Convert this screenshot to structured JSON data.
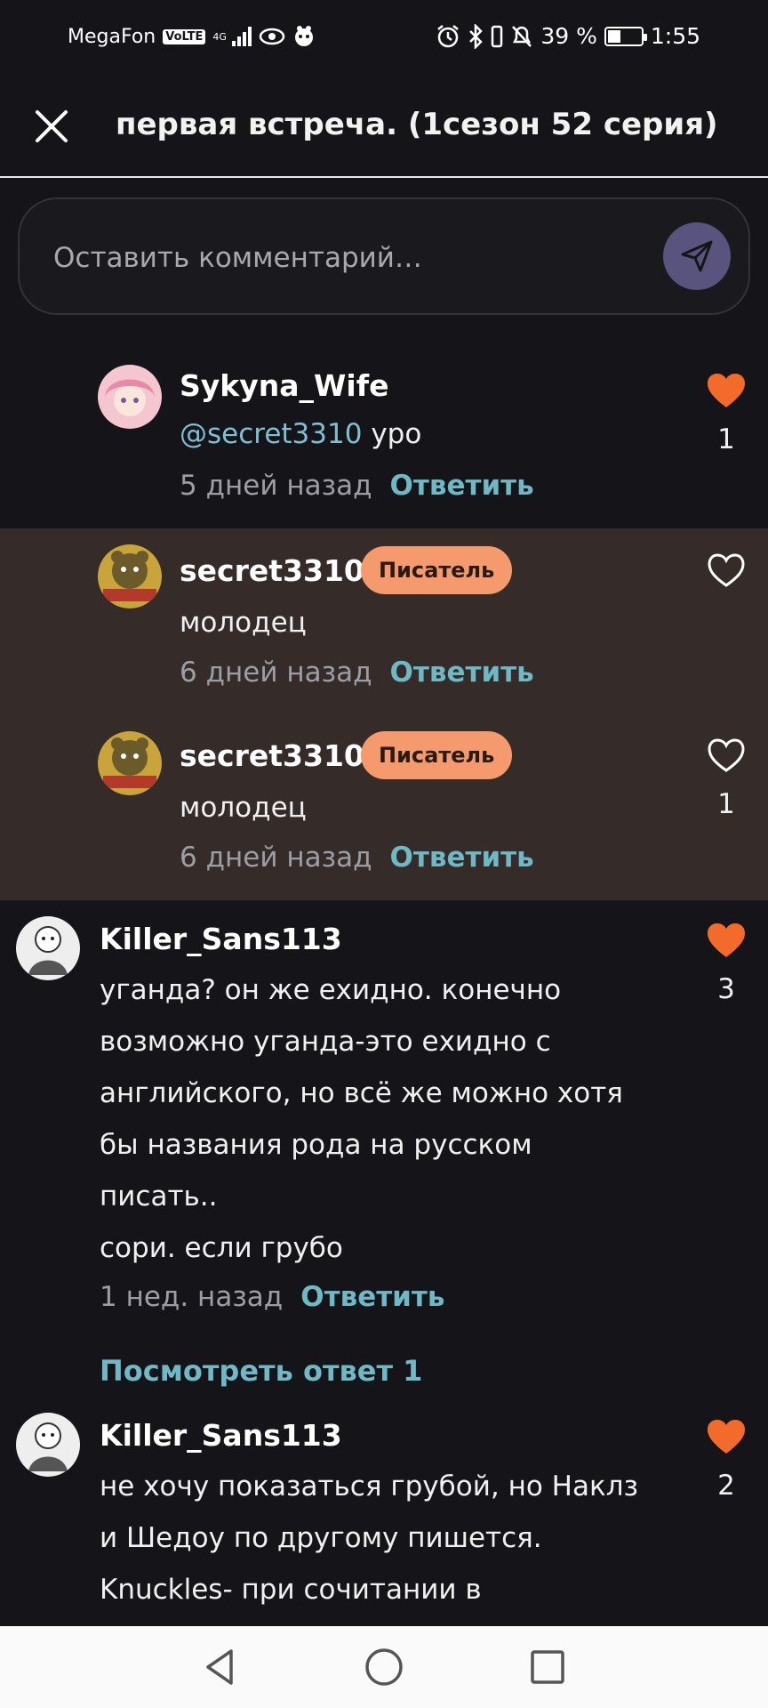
{
  "status_bar": {
    "carrier": "MegaFon",
    "volte": "VoLTE",
    "network": "4G",
    "battery_percent": "39 %",
    "battery_level": 0.39,
    "time": "1:55"
  },
  "header": {
    "title": "первая встреча. (1сезон 52 серия)"
  },
  "comment_input": {
    "placeholder": "Оставить комментарий…"
  },
  "comments": [
    {
      "username": "Sykyna_Wife",
      "mention": "@secret3310",
      "text": "уро",
      "time": "5 дней назад",
      "reply_label": "Ответить",
      "liked": true,
      "likes": "1"
    },
    {
      "username": "secret3310",
      "badge": "Писатель",
      "text": "молодец",
      "time": "6 дней назад",
      "reply_label": "Ответить",
      "liked": false,
      "likes": ""
    },
    {
      "username": "secret3310",
      "badge": "Писатель",
      "text": "молодец",
      "time": "6 дней назад",
      "reply_label": "Ответить",
      "liked": false,
      "likes": "1"
    },
    {
      "username": "Killer_Sans113",
      "lines": [
        "уганда?  он же ехидно. конечно",
        "возможно уганда-это ехидно с",
        "английского, но всё же можно хотя",
        "бы названия рода на русском",
        "писать..",
        "сори. если грубо"
      ],
      "time": "1 нед. назад",
      "reply_label": "Ответить",
      "liked": true,
      "likes": "3"
    },
    {
      "username": "Killer_Sans113",
      "lines": [
        "не хочу показаться грубой, но Наклз",
        "и Шедоу по другому пишется.",
        "Knuckles- при сочитании в"
      ],
      "liked": true,
      "likes": "2"
    }
  ],
  "view_replies": "Посмотреть ответ 1",
  "colors": {
    "background": "#151419",
    "reply_background": "#352b29",
    "accent_link": "#6fb8c6",
    "heart": "#f26b2a",
    "badge": "#f59a6d",
    "send_button": "#59547e"
  },
  "icons": {
    "close": "close-icon",
    "send": "send-icon",
    "heart_filled": "heart-filled-icon",
    "heart_outline": "heart-outline-icon",
    "nav_back": "back-triangle-icon",
    "nav_home": "home-circle-icon",
    "nav_recents": "recents-square-icon"
  }
}
